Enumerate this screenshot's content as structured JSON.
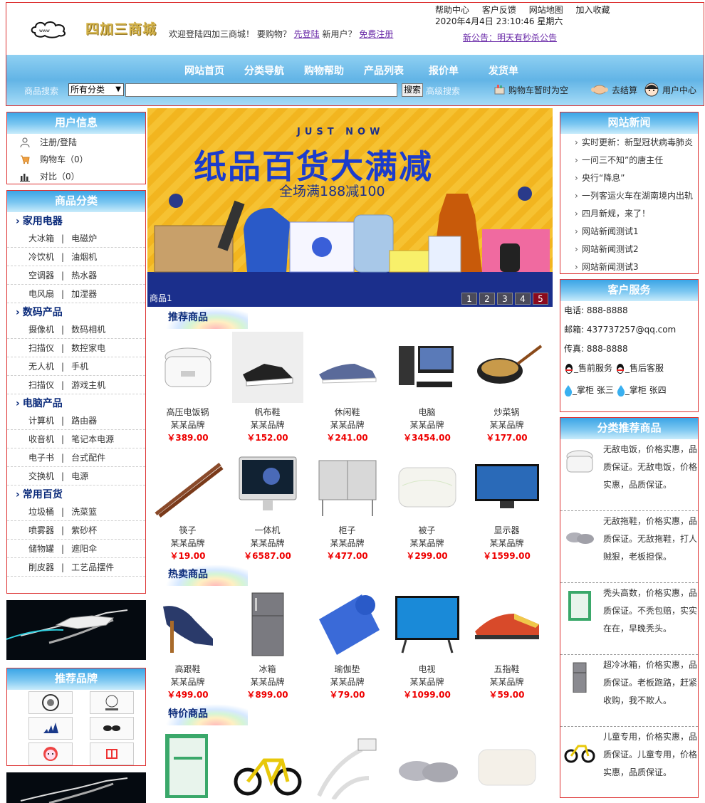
{
  "header": {
    "logo_text": "四加三商城",
    "welcome_prefix": "欢迎登陆四加三商城！ 要购物？",
    "login_link": "先登陆",
    "new_user": "新用户？",
    "register_link": "免费注册",
    "top_links": [
      "帮助中心",
      "客户反馈",
      "网站地图",
      "加入收藏"
    ],
    "datetime": "2020年4月4日 23:10:46 星期六",
    "notice": "新公告：明天有秒杀公告"
  },
  "nav": {
    "items": [
      "网站首页",
      "分类导航",
      "购物帮助",
      "产品列表",
      "报价单",
      "发货单"
    ],
    "search_label": "商品搜索",
    "search_category": "所有分类",
    "search_button": "搜索",
    "advanced_search": "高级搜索",
    "cart_text": "购物车暂时为空",
    "checkout": "去结算",
    "user_center": "用户中心"
  },
  "user_info": {
    "title": "用户信息",
    "items": [
      "注册/登陆",
      "购物车（0）",
      "对比（0）"
    ]
  },
  "categories": {
    "title": "商品分类",
    "groups": [
      {
        "name": "家用电器",
        "rows": [
          [
            "大冰箱",
            "电磁炉"
          ],
          [
            "冷饮机",
            "油烟机"
          ],
          [
            "空调器",
            "热水器"
          ],
          [
            "电风扇",
            "加湿器"
          ]
        ]
      },
      {
        "name": "数码产品",
        "rows": [
          [
            "摄像机",
            "数码相机"
          ],
          [
            "扫描仪",
            "数控家电"
          ],
          [
            "无人机",
            "手机"
          ],
          [
            "扫描仪",
            "游戏主机"
          ]
        ]
      },
      {
        "name": "电脑产品",
        "rows": [
          [
            "计算机",
            "路由器"
          ],
          [
            "收音机",
            "笔记本电源"
          ],
          [
            "电子书",
            "台式配件"
          ],
          [
            "交换机",
            "电源"
          ]
        ]
      },
      {
        "name": "常用百货",
        "rows": [
          [
            "垃圾桶",
            "洗菜篮"
          ],
          [
            "喷雾器",
            "紫砂杯"
          ],
          [
            "储物罐",
            "遮阳伞"
          ],
          [
            "削皮器",
            "工艺品摆件"
          ]
        ]
      }
    ]
  },
  "brands": {
    "title": "推荐品牌"
  },
  "hero": {
    "kicker": "JUST NOW",
    "title": "纸品百货大满减",
    "subtitle": "全场满188减100",
    "caption": "商品1",
    "pages": [
      "1",
      "2",
      "3",
      "4",
      "5"
    ],
    "active_page": "5"
  },
  "sections": {
    "recommended": "推荐商品",
    "hot": "热卖商品",
    "special": "特价商品"
  },
  "recommended_products": [
    {
      "name": "高压电饭锅",
      "brand": "某某品牌",
      "price": "￥389.00"
    },
    {
      "name": "帆布鞋",
      "brand": "某某品牌",
      "price": "￥152.00"
    },
    {
      "name": "休闲鞋",
      "brand": "某某品牌",
      "price": "￥241.00"
    },
    {
      "name": "电脑",
      "brand": "某某品牌",
      "price": "￥3454.00"
    },
    {
      "name": "炒菜锅",
      "brand": "某某品牌",
      "price": "￥177.00"
    },
    {
      "name": "筷子",
      "brand": "某某品牌",
      "price": "￥19.00"
    },
    {
      "name": "一体机",
      "brand": "某某品牌",
      "price": "￥6587.00"
    },
    {
      "name": "柜子",
      "brand": "某某品牌",
      "price": "￥477.00"
    },
    {
      "name": "被子",
      "brand": "某某品牌",
      "price": "￥299.00"
    },
    {
      "name": "显示器",
      "brand": "某某品牌",
      "price": "￥1599.00"
    }
  ],
  "hot_products": [
    {
      "name": "高跟鞋",
      "brand": "某某品牌",
      "price": "￥499.00"
    },
    {
      "name": "冰箱",
      "brand": "某某品牌",
      "price": "￥899.00"
    },
    {
      "name": "瑜伽垫",
      "brand": "某某品牌",
      "price": "￥79.00"
    },
    {
      "name": "电视",
      "brand": "某某品牌",
      "price": "￥1099.00"
    },
    {
      "name": "五指鞋",
      "brand": "某某品牌",
      "price": "￥59.00"
    }
  ],
  "news": {
    "title": "网站新闻",
    "items": [
      "实时更新：新型冠状病毒肺炎",
      "一问三不知”的唐主任",
      "央行“降息”",
      "一列客运火车在湖南境内出轨",
      "四月新规，来了！",
      "网站新闻测试1",
      "网站新闻测试2",
      "网站新闻测试3"
    ]
  },
  "service": {
    "title": "客户服务",
    "phone": "电话: 888-8888",
    "email": "邮箱: 437737257@qq.com",
    "fax": "传真: 888-8888",
    "presale": "_售前服务",
    "aftersale": "_售后客服",
    "keeper1": "_掌柜 张三",
    "keeper2": "_掌柜 张四"
  },
  "category_recommend": {
    "title": "分类推荐商品",
    "items": [
      "无敌电饭，价格实惠，品质保证。无敌电饭，价格实惠，品质保证。",
      "无敌拖鞋，价格实惠，品质保证。无敌拖鞋，打人贼狠，老板担保。",
      "秃头高数，价格实惠，品质保证。不秃包赔，实实在在，早晚秃头。",
      "超冷冰箱，价格实惠，品质保证。老板跑路，赶紧收购，我不欺人。",
      "儿童专用，价格实惠，品质保证。儿童专用，价格实惠，品质保证。"
    ]
  }
}
